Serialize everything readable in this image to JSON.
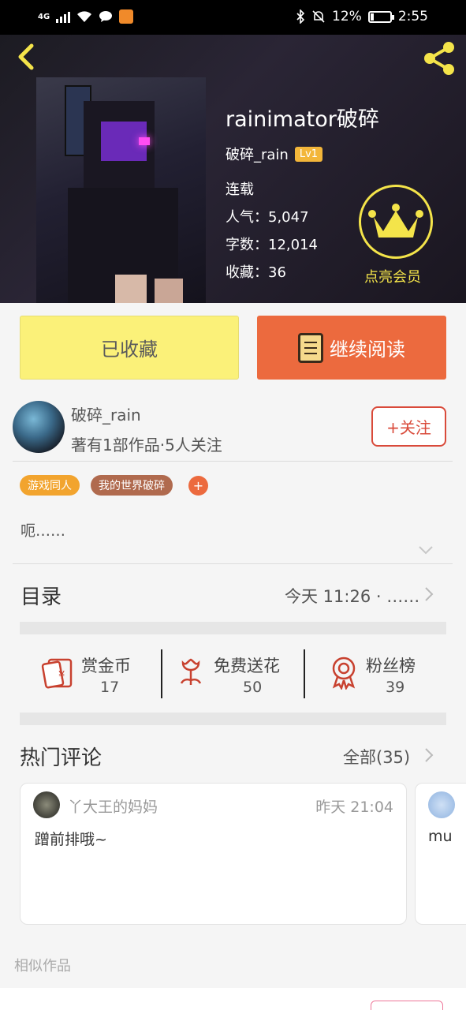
{
  "status_bar": {
    "network": "4G",
    "battery": "12%",
    "time": "2:55"
  },
  "book": {
    "title": "rainimator破碎",
    "author": "破碎_rain",
    "level": "Lv1",
    "status": "连载",
    "popularity_label": "人气：",
    "popularity": "5,047",
    "words_label": "字数：",
    "words": "12,014",
    "favorites_label": "收藏：",
    "favorites": "36",
    "vip_label": "点亮会员"
  },
  "actions": {
    "favorited_label": "已收藏",
    "continue_label": "继续阅读"
  },
  "author_info": {
    "name": "破碎_rain",
    "meta": "著有1部作品·5人关注",
    "follow_label": "+关注"
  },
  "tags": [
    "游戏同人",
    "我的世界破碎"
  ],
  "tag_add": "+",
  "description": "呃……",
  "catalog": {
    "title": "目录",
    "latest": "今天 11:26 · ……"
  },
  "stats": {
    "reward_label": "赏金币",
    "reward_value": "17",
    "flower_label": "免费送花",
    "flower_value": "50",
    "fans_label": "粉丝榜",
    "fans_value": "39"
  },
  "comments": {
    "title": "热门评论",
    "all_label": "全部(35)",
    "items": [
      {
        "user": "丫大王的妈妈",
        "time": "昨天 21:04",
        "text": "蹭前排哦~"
      },
      {
        "user": "",
        "time": "",
        "text": "mu"
      }
    ]
  },
  "similar_title": "相似作品",
  "colors": {
    "accent_orange": "#ec6a3e",
    "fav_yellow": "#fbf179",
    "vip_gold": "#f4e44a",
    "follow_red": "#d94a3a"
  }
}
